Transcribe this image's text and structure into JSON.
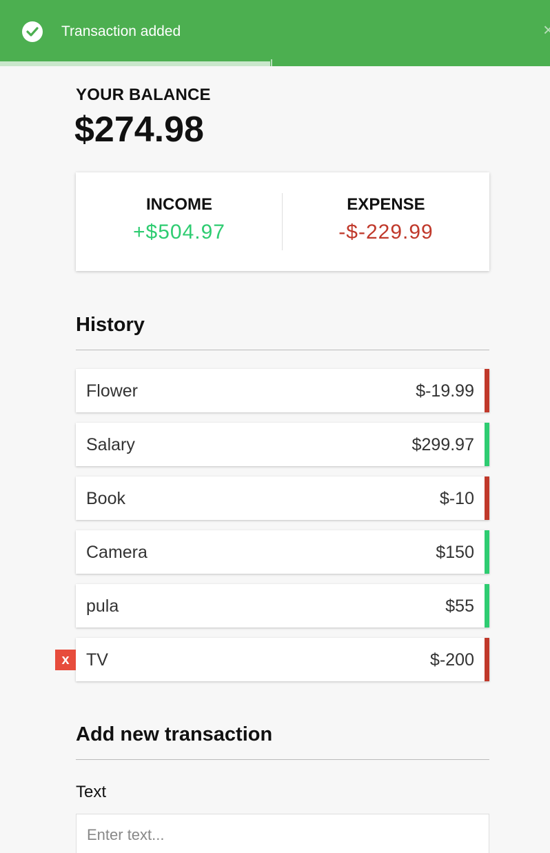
{
  "toast": {
    "message": "Transaction added",
    "icon": "check-circle-icon",
    "close": "×",
    "color": "#4caf50"
  },
  "balance": {
    "label": "YOUR BALANCE",
    "value": "$274.98"
  },
  "summary": {
    "income_label": "INCOME",
    "income_value": "+$504.97",
    "expense_label": "EXPENSE",
    "expense_value": "-$-229.99",
    "income_color": "#2ecc71",
    "expense_color": "#c0392b"
  },
  "history": {
    "title": "History",
    "items": [
      {
        "text": "Flower",
        "amount": "$-19.99",
        "type": "minus"
      },
      {
        "text": "Salary",
        "amount": "$299.97",
        "type": "plus"
      },
      {
        "text": "Book",
        "amount": "$-10",
        "type": "minus"
      },
      {
        "text": "Camera",
        "amount": "$150",
        "type": "plus"
      },
      {
        "text": "pula",
        "amount": "$55",
        "type": "plus"
      },
      {
        "text": "TV",
        "amount": "$-200",
        "type": "minus"
      }
    ],
    "delete_label": "x"
  },
  "form": {
    "title": "Add new transaction",
    "text_label": "Text",
    "text_placeholder": "Enter text..."
  }
}
